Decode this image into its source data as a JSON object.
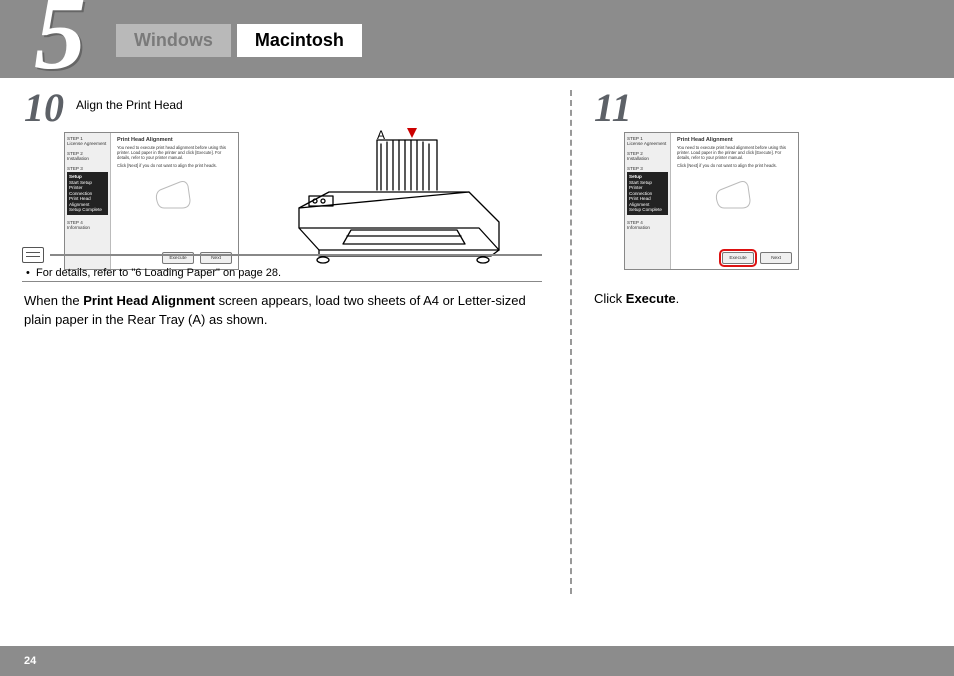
{
  "header": {
    "section_number": "5",
    "tabs": [
      {
        "label": "Windows",
        "active": false
      },
      {
        "label": "Macintosh",
        "active": true
      }
    ]
  },
  "dialog": {
    "title": "Print Head Alignment",
    "body_line1": "You need to execute print head alignment before using this printer. Load paper in the printer and click [Execute]. For details, refer to your printer manual.",
    "body_line2": "Click [Next] if you do not want to align the print heads.",
    "sidebar": {
      "step1_label": "STEP 1",
      "step1_item": "License Agreement",
      "step2_label": "STEP 2",
      "step2_item": "Installation",
      "step3_label": "STEP 3",
      "setup_title": "Setup",
      "setup_items": [
        "Start Setup",
        "Printer Connection",
        "Print Head Alignment",
        "Setup Complete"
      ],
      "step4_label": "STEP 4",
      "step4_item": "Information"
    },
    "buttons": {
      "execute": "Execute",
      "next": "Next"
    }
  },
  "steps": [
    {
      "number": "10",
      "title": "Align the Print Head",
      "printer_label": "A",
      "instruction_pre": "When the ",
      "instruction_bold": "Print Head Alignment",
      "instruction_post": " screen appears, load two sheets of A4 or Letter-sized plain paper in the Rear Tray (A) as shown.",
      "note_bullet": "•",
      "note_text": "For details, refer to \"6 Loading Paper\" on page 28."
    },
    {
      "number": "11",
      "instruction_pre": "Click ",
      "instruction_bold": "Execute",
      "instruction_post": "."
    }
  ],
  "footer": {
    "page_number": "24"
  }
}
